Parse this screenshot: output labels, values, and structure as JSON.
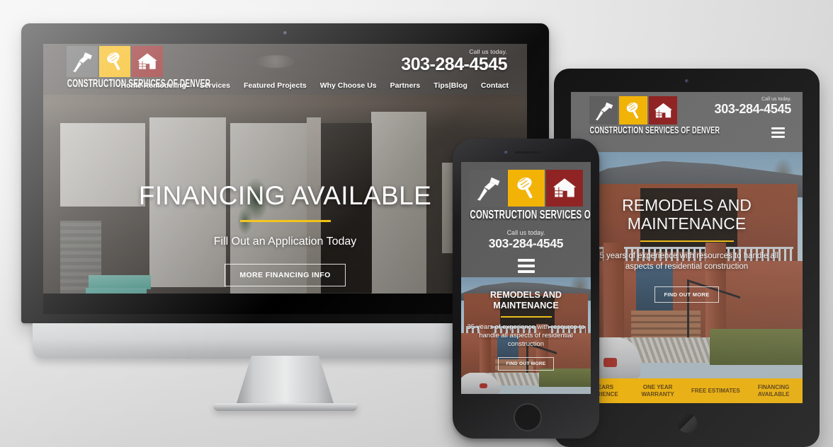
{
  "brand": {
    "name": "CONSTRUCTION SERVICES OF DENVER",
    "icon_hammer": "hammer-icon",
    "icon_trowel": "trowel-icon",
    "icon_house": "house-icon",
    "colors": {
      "tile_gray": "#5d5d5d",
      "tile_gold": "#f5b400",
      "tile_red": "#8f1d1d",
      "accent_yellow": "#f2c00c",
      "header_gray": "#5b5b5b"
    }
  },
  "contact": {
    "call_label": "Call us today.",
    "phone": "303-284-4545"
  },
  "desktop": {
    "nav": [
      {
        "label": "Home Remodeling"
      },
      {
        "label": "Services"
      },
      {
        "label": "Featured Projects"
      },
      {
        "label": "Why Choose Us"
      },
      {
        "label": "Partners"
      },
      {
        "label": "Tips|Blog"
      },
      {
        "label": "Contact"
      }
    ],
    "hero": {
      "headline": "FINANCING AVAILABLE",
      "subhead": "Fill Out an Application Today",
      "button": "MORE FINANCING INFO"
    }
  },
  "tablet": {
    "menu_icon": "hamburger-menu-icon",
    "hero": {
      "headline": "REMODELS AND MAINTENANCE",
      "subhead": "35 years of experience with resources to handle all aspects of residential construction",
      "button": "FIND OUT MORE"
    },
    "feature_bar": [
      {
        "line1": "35 YEARS",
        "line2": "EXPERIENCE"
      },
      {
        "line1": "ONE YEAR",
        "line2": "WARRANTY"
      },
      {
        "line1": "FREE ESTIMATES",
        "line2": ""
      },
      {
        "line1": "FINANCING",
        "line2": "AVAILABLE"
      }
    ]
  },
  "phone": {
    "menu_icon": "hamburger-menu-icon",
    "hero": {
      "headline": "REMODELS AND MAINTENANCE",
      "subhead": "35 years of experience with resource to handle all aspects of residential construction",
      "button": "FIND OUT MORE"
    }
  }
}
